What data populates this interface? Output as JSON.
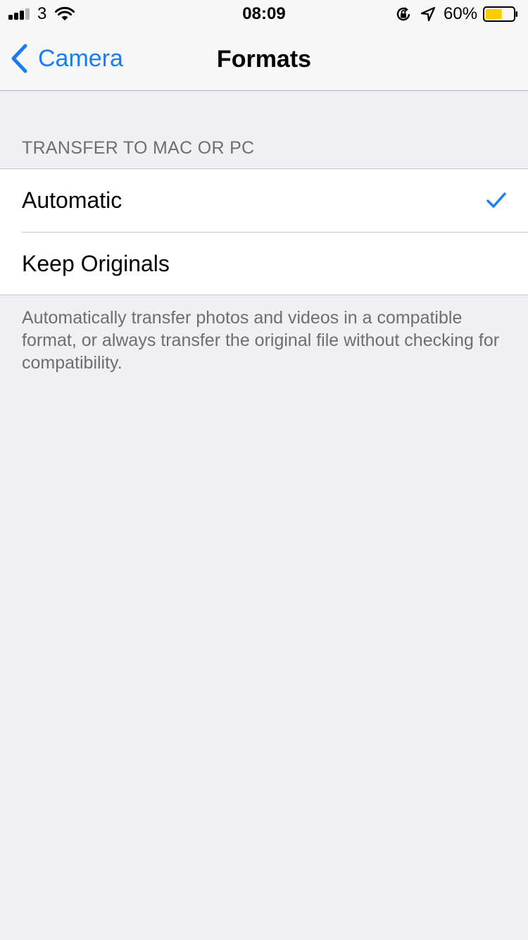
{
  "status_bar": {
    "carrier": "3",
    "time": "08:09",
    "battery_percent": "60%",
    "battery_level": 0.6,
    "battery_color": "#ffcc00"
  },
  "nav": {
    "back_label": "Camera",
    "title": "Formats",
    "tint_color": "#1a7cf5"
  },
  "section": {
    "header": "TRANSFER TO MAC OR PC",
    "options": [
      {
        "label": "Automatic",
        "selected": true
      },
      {
        "label": "Keep Originals",
        "selected": false
      }
    ],
    "footer": "Automatically transfer photos and videos in a compatible format, or always transfer the original file without checking for compatibility."
  },
  "icons": {
    "signal": "signal-bars-icon",
    "wifi": "wifi-icon",
    "rotation_lock": "rotation-lock-icon",
    "location": "location-arrow-icon",
    "battery": "battery-icon",
    "back": "chevron-left-icon",
    "check": "checkmark-icon"
  }
}
